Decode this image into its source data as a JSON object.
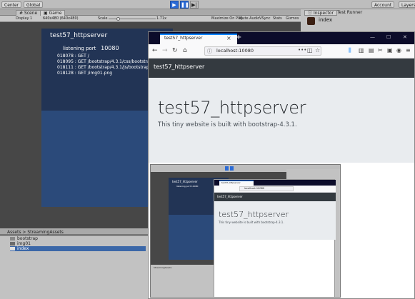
{
  "unity": {
    "toolbar": {
      "center": "Center",
      "global": "Global",
      "account": "Account",
      "layers": "Layers"
    },
    "tabs": {
      "scene": "Scene",
      "game": "Game"
    },
    "game_toolbar": {
      "display": "Display 1",
      "resolution": "640x480 (640x480)",
      "scale_label": "Scale",
      "scale_value": "1.71x",
      "maximize": "Maximize On Play",
      "mute": "Mute Audio",
      "vsync": "VSync",
      "stats": "Stats",
      "gizmos": "Gizmos"
    },
    "game_view": {
      "title": "test57_httpserver",
      "port_label": "listening port",
      "port_value": "10080",
      "log": [
        "018078 : GET /",
        "018095 : GET /bootstrap/4.3.1/css/bootstrap.",
        "018111 : GET /bootstrap/4.3.1/js/bootstrap.m",
        "018128 : GET /img01.png"
      ]
    },
    "inspector": {
      "tab": "Inspector",
      "test_runner": "Test Runner",
      "object": "index"
    },
    "project": {
      "breadcrumb": "Assets > StreamingAssets",
      "items": [
        "bootstrap",
        "img01",
        "index"
      ]
    }
  },
  "firefox": {
    "tab_title": "test57_httpserver",
    "url": "localhost:10080",
    "page": {
      "brand": "test57_httpserver",
      "heading": "test57_httpserver",
      "lead": "This tiny website is built with bootstrap-4.3.1."
    }
  },
  "nested": {
    "game_title": "test57_httpserver",
    "port": "listening port   10080",
    "tab_title": "test57_httpserver",
    "url": "localhost:10080",
    "brand": "test57_httpserver",
    "heading": "test57_httpserver",
    "lead": "This tiny website is built with bootstrap-4.3.1.",
    "project_label": "StreamingAssets"
  }
}
